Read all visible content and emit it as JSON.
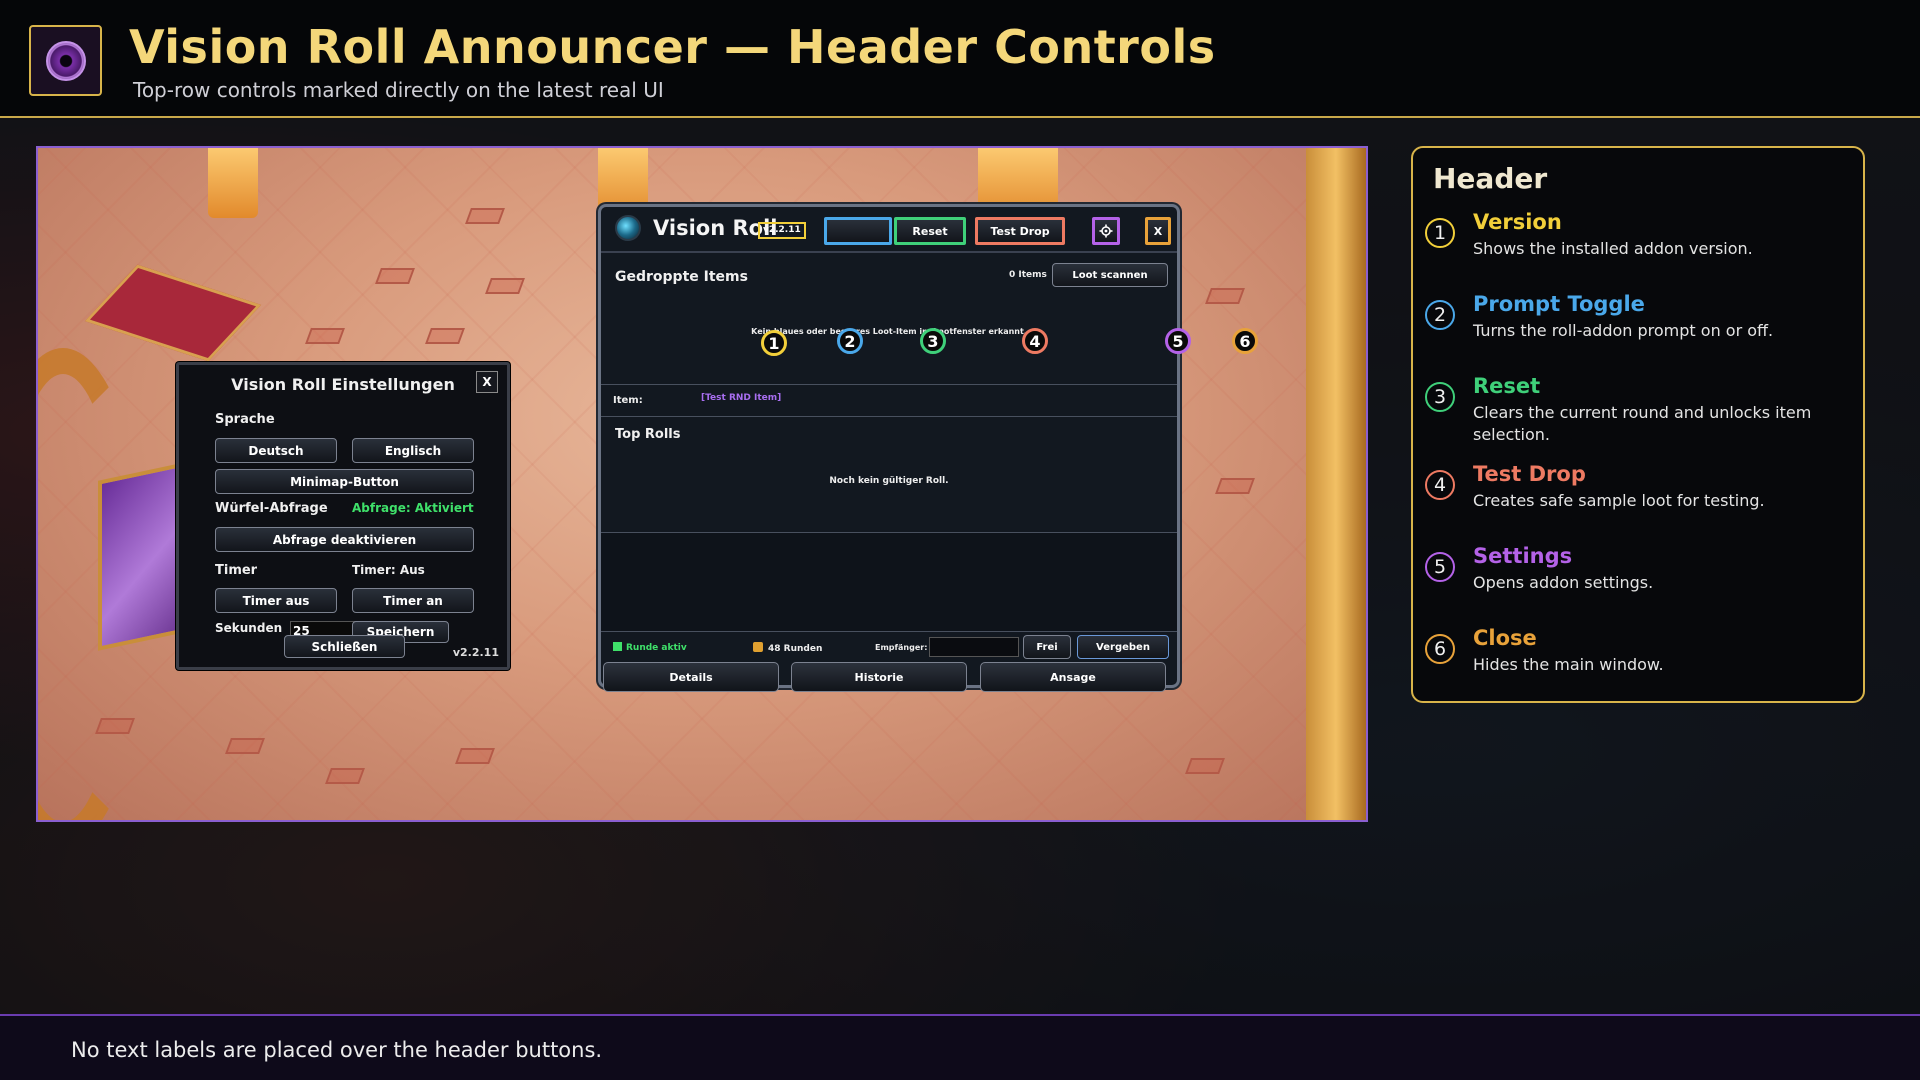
{
  "header": {
    "title": "Vision Roll Announcer — Header Controls",
    "subtitle": "Top-row controls marked directly on the latest real UI"
  },
  "settings_panel": {
    "title": "Vision Roll Einstellungen",
    "close_label": "X",
    "language_label": "Sprache",
    "btn_german": "Deutsch",
    "btn_english": "Englisch",
    "btn_minimap": "Minimap-Button",
    "dice_prompt_label": "Würfel-Abfrage",
    "dice_prompt_status": "Abfrage: Aktiviert",
    "btn_disable_prompt": "Abfrage deaktivieren",
    "timer_label": "Timer",
    "timer_status": "Timer: Aus",
    "btn_timer_off": "Timer aus",
    "btn_timer_on": "Timer an",
    "seconds_label": "Sekunden",
    "seconds_value": "25",
    "btn_save": "Speichern",
    "btn_close": "Schließen",
    "version": "v2.2.11"
  },
  "main_window": {
    "title": "Vision Roll",
    "version": "v2.2.11",
    "btn_reset": "Reset",
    "btn_test_drop": "Test Drop",
    "settings_icon": "gear-icon",
    "close_label": "X",
    "dropped_items_title": "Gedroppte Items",
    "item_count": "0 Items",
    "btn_scan_loot": "Loot scannen",
    "empty_loot_message": "Kein blaues oder besseres Loot-Item im Lootfenster erkannt.",
    "item_label": "Item:",
    "item_value": "[Test RND Item]",
    "top_rolls_title": "Top Rolls",
    "no_roll_message": "Noch kein gültiger Roll.",
    "round_status": "Runde aktiv",
    "rounds_count": "48 Runden",
    "recipient_label": "Empfänger:",
    "btn_free": "Frei",
    "btn_assign": "Vergeben",
    "tab_details": "Details",
    "tab_history": "Historie",
    "tab_announce": "Ansage"
  },
  "markers": [
    "1",
    "2",
    "3",
    "4",
    "5",
    "6"
  ],
  "legend": {
    "title": "Header",
    "items": [
      {
        "num": "1",
        "name": "Version",
        "desc": "Shows the installed addon version.",
        "color": "#f2cf3a"
      },
      {
        "num": "2",
        "name": "Prompt Toggle",
        "desc": "Turns the roll-addon prompt on or off.",
        "color": "#4aa8ea"
      },
      {
        "num": "3",
        "name": "Reset",
        "desc": "Clears the current round and unlocks item selection.",
        "color": "#3fd07a"
      },
      {
        "num": "4",
        "name": "Test Drop",
        "desc": "Creates safe sample loot for testing.",
        "color": "#ee7a62"
      },
      {
        "num": "5",
        "name": "Settings",
        "desc": "Opens addon settings.",
        "color": "#b462e8"
      },
      {
        "num": "6",
        "name": "Close",
        "desc": "Hides the main window.",
        "color": "#e8a23a"
      }
    ]
  },
  "footer": {
    "note": "No text labels are placed over the header buttons."
  }
}
